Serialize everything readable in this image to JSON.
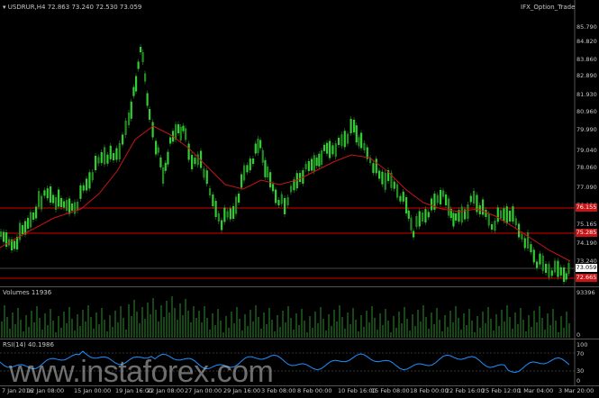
{
  "header": {
    "symbol_line": "USDRUR,H4  72.863 73.240 72.530 73.059",
    "indicator": "IFX_Option_Trade"
  },
  "price_axis": [
    "85.790",
    "84.820",
    "83.860",
    "82.890",
    "81.930",
    "80.960",
    "79.990",
    "79.040",
    "78.060",
    "77.090",
    "76.130",
    "75.165",
    "74.190",
    "73.240",
    "72.265"
  ],
  "price_tags": {
    "current": "73.059",
    "red_high": "76.155",
    "red_mid": "75.285",
    "red_low": "72.665"
  },
  "volumes": {
    "label": "Volumes 11936",
    "top_value": "93396",
    "bottom_value": "0"
  },
  "rsi": {
    "label": "RSI(14) 40.1986",
    "levels": [
      "100",
      "70",
      "30",
      "0"
    ]
  },
  "time_axis": [
    "7 Jan 2016",
    "12 Jan 08:00",
    "15 Jan 00:00",
    "19 Jan 16:00",
    "22 Jan 08:00",
    "27 Jan 00:00",
    "29 Jan 16:00",
    "3 Feb 08:00",
    "8 Feb 00:00",
    "10 Feb 16:00",
    "15 Feb 08:00",
    "18 Feb 00:00",
    "22 Feb 16:00",
    "25 Feb 12:00",
    "1 Mar 04:00",
    "3 Mar 20:00"
  ],
  "watermark": "www.instaforex.com",
  "colors": {
    "bull": "#32cd32",
    "bear": "#228b22",
    "ma": "#c81414",
    "rsi": "#1e90ff",
    "hline": "#dc0000"
  }
}
